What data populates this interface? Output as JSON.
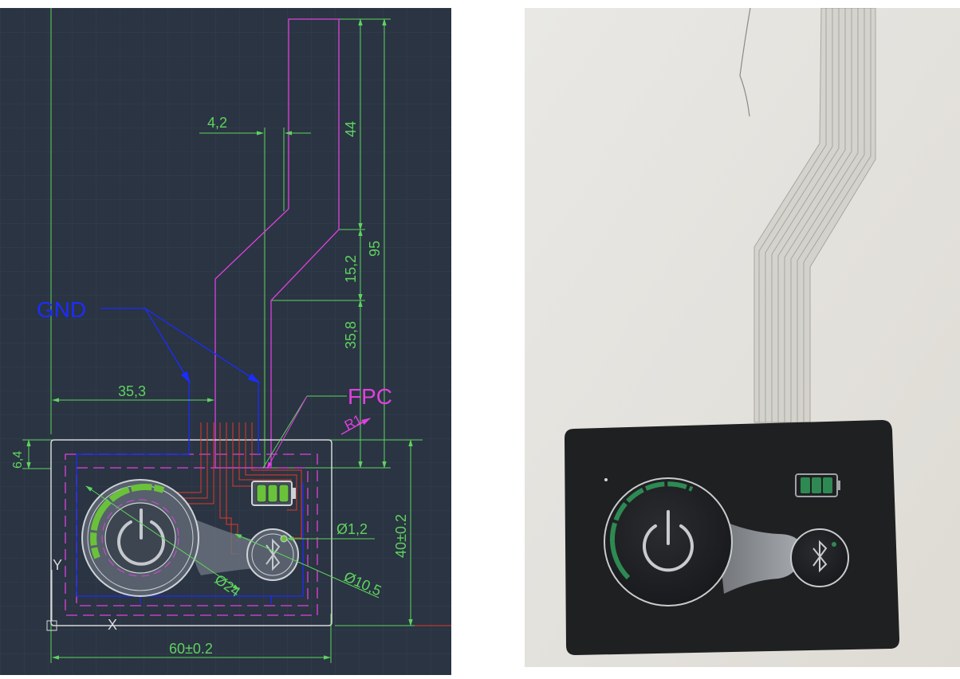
{
  "colors": {
    "cad_background": "#2a3442",
    "grid": "#34404f",
    "dimension": "#5fd35f",
    "outline": "#d8d8d8",
    "fpc": "#e040e0",
    "gnd": "#1c2cff",
    "trace": "#e03a2a",
    "led": "#6ac23a",
    "photo_background": "#e9e7e2",
    "panel_black": "#1f2022"
  },
  "drawing": {
    "dimensions": {
      "fpc_width": "4,2",
      "tail_upper": "44",
      "total_height": "95",
      "tail_bend": "15,2",
      "tail_lower": "35,8",
      "gnd_offset": "35,3",
      "tail_edge": "6,4",
      "corner_radius": "R1",
      "led_hole": "Ø1,2",
      "ble_button": "Ø10,5",
      "power_button": "Ø24",
      "panel_height": "40±0.2",
      "panel_width": "60±0.2"
    },
    "labels": {
      "gnd": "GND",
      "fpc": "FPC",
      "axis_y": "Y",
      "axis_x": "X"
    },
    "icons": [
      "power-icon",
      "battery-icon",
      "bluetooth-icon"
    ]
  },
  "photo": {
    "icons": [
      "power-icon",
      "battery-icon",
      "bluetooth-icon"
    ],
    "battery_bars": 3
  }
}
